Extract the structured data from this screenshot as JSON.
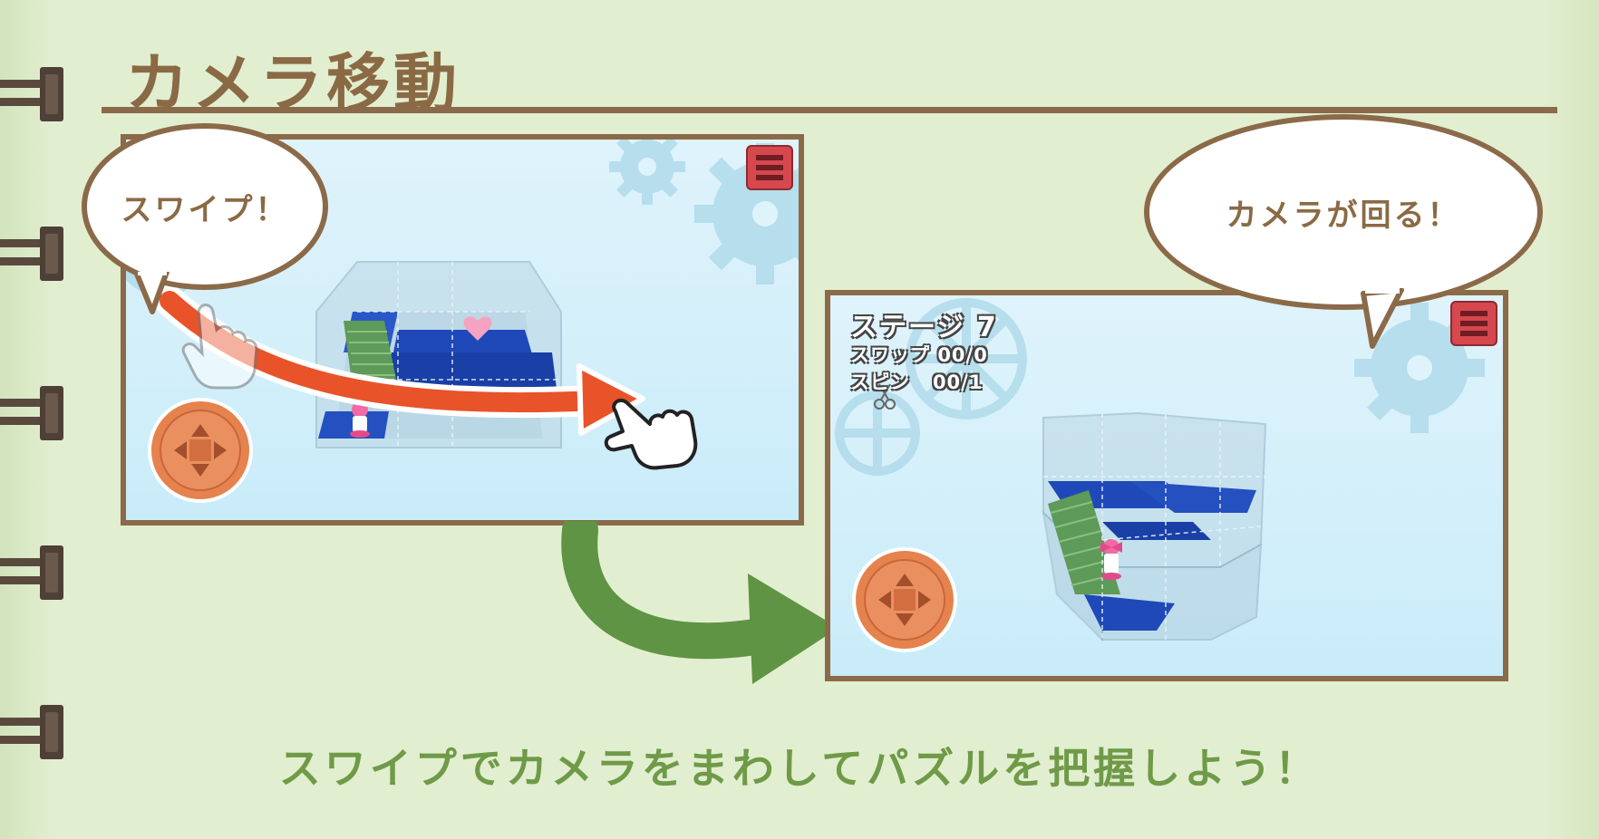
{
  "header": {
    "title": "カメラ移動"
  },
  "scenes": {
    "before": {
      "bubble_text": "スワイプ！"
    },
    "after": {
      "bubble_text": "カメラが回る！",
      "hud": {
        "stage_label": "ステージ 7",
        "swap_label": "スワップ",
        "swap_value": "00/0",
        "spin_label": "スピン",
        "spin_value": "00/1"
      }
    }
  },
  "footer": {
    "caption": "スワイプでカメラをまわしてパズルを把握しよう！"
  },
  "icons": [
    "menu-icon",
    "dpad-icon",
    "hand-pointer-icon",
    "gear-icon",
    "scissors-icon",
    "notebook-ring-icon"
  ],
  "colors": {
    "background": "#dfeccb",
    "frame": "#8b6a49",
    "title": "#8a6a45",
    "caption": "#6f9a48",
    "swipe_arrow": "#e8532a",
    "transition_arrow": "#5f9444",
    "menu_button": "#d6484e",
    "dpad_button": "#e5824d",
    "floor_tile": "#1f49b8"
  }
}
